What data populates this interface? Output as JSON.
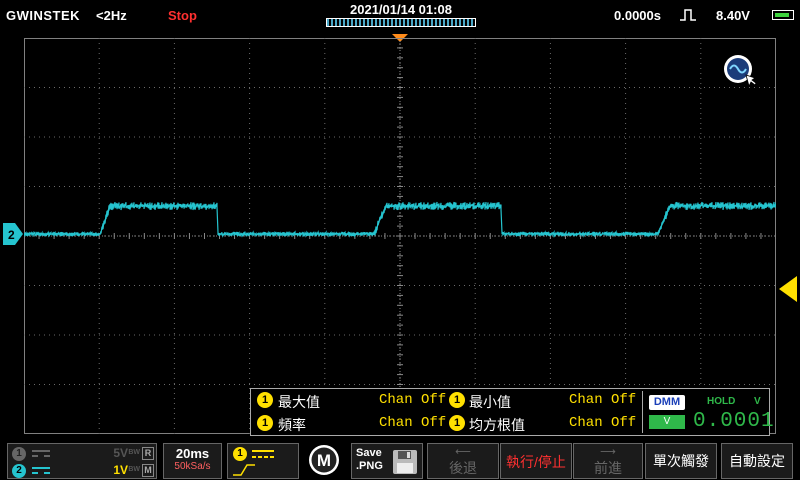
{
  "top_bar": {
    "brand": "GWINSTEK",
    "trigger_freq": "<2Hz",
    "run_state": "Stop",
    "datetime": "2021/01/14  01:08",
    "horizontal_delay": "0.0000s",
    "trigger_level": "8.40V",
    "accent_color": "#ff3030"
  },
  "waveform": {
    "channel": "2",
    "color": "#25c4cf",
    "trigger_marker_color": "#ffe000"
  },
  "measurements": {
    "rows": [
      {
        "num": "1",
        "label": "最大值",
        "value": "Chan Off",
        "num2": "1",
        "label2": "最小值",
        "value2": "Chan Off"
      },
      {
        "num": "1",
        "label": "頻率",
        "value": "Chan Off",
        "num2": "1",
        "label2": "均方根值",
        "value2": "Chan Off"
      }
    ],
    "dmm": {
      "badge": "DMM",
      "mode": "V",
      "hold": "HOLD",
      "unit": "V",
      "value": "0.0001"
    }
  },
  "channels": [
    {
      "num": "1",
      "scale": "5V",
      "bw": "BW",
      "badge": "R",
      "color": "#aaaaaa",
      "text_color": "#555555"
    },
    {
      "num": "2",
      "scale": "1V",
      "bw": "BW",
      "badge": "M",
      "color": "#25c4cf",
      "text_color": "#ffe000"
    }
  ],
  "timebase": {
    "scale": "20ms",
    "sample_rate": "50kSa/s"
  },
  "trigger_panel": {
    "source": "1"
  },
  "menu_button": "M",
  "save_button": {
    "line1": "Save",
    "line2": ".PNG"
  },
  "softkeys": {
    "prev": "後退",
    "run_stop": "執行/停止",
    "next": "前進",
    "single": "單次觸發",
    "auto": "自動設定"
  }
}
